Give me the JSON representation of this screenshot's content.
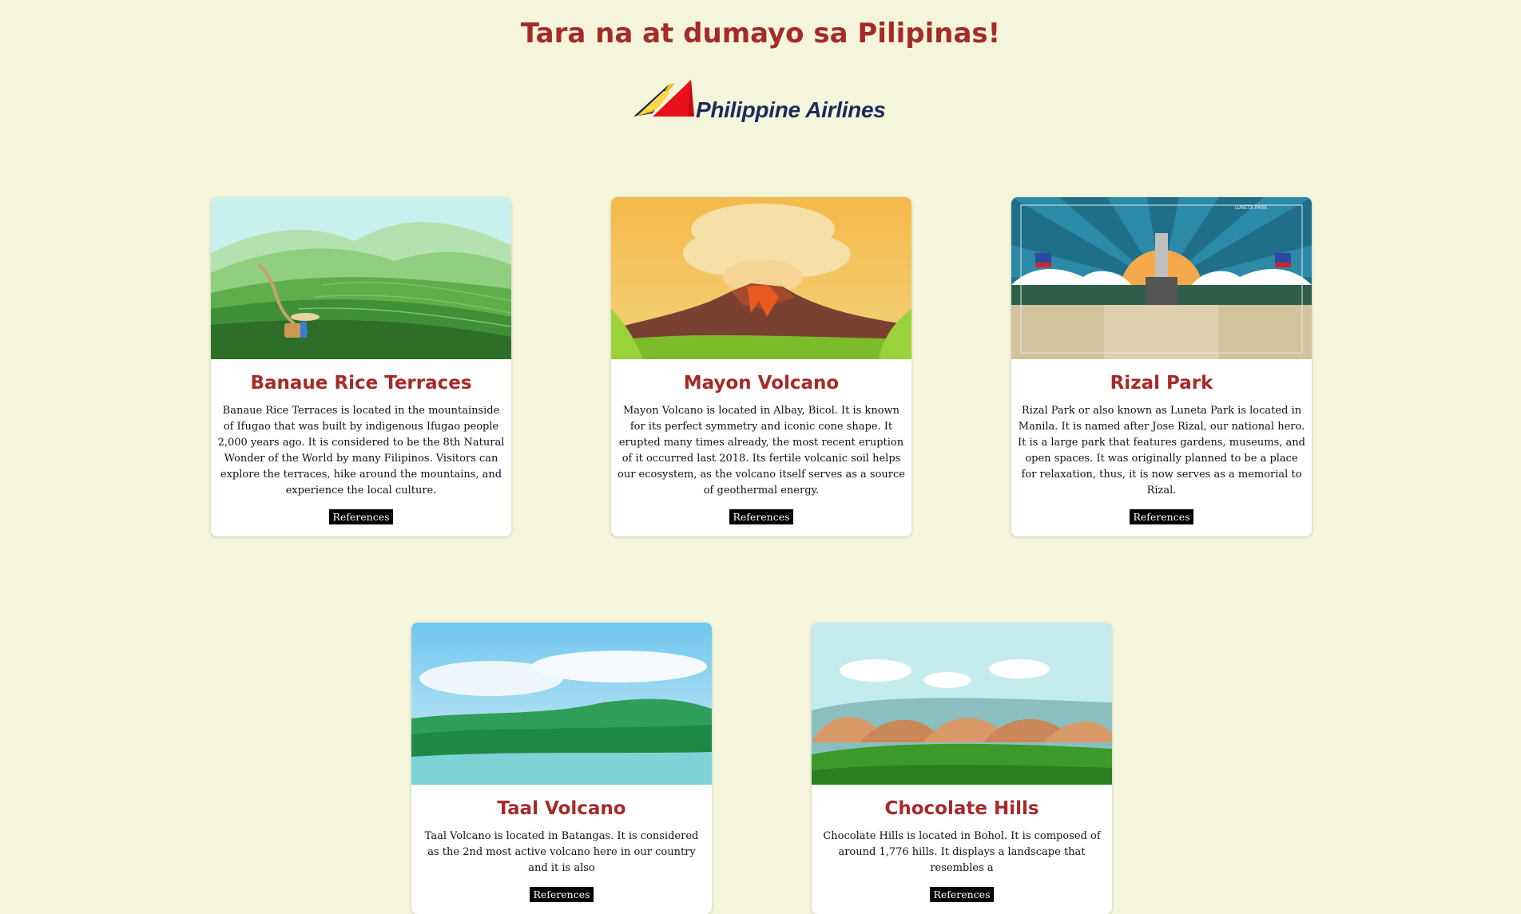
{
  "header": {
    "title": "Tara na at dumayo sa Pilipinas!",
    "logo_text": "Philippine Airlines"
  },
  "colors": {
    "background": "#f5f5dc",
    "accent": "#a52a2a",
    "button": "#000000"
  },
  "cards": [
    {
      "title": "Banaue Rice Terraces",
      "description": "Banaue Rice Terraces is located in the mountainside of Ifugao that was built by indigenous Ifugao people 2,000 years ago. It is considered to be the 8th Natural Wonder of the World by many Filipinos. Visitors can explore the terraces, hike around the mountains, and experience the local culture.",
      "button": "References"
    },
    {
      "title": "Mayon Volcano",
      "description": "Mayon Volcano is located in Albay, Bicol. It is known for its perfect symmetry and iconic cone shape. It erupted many times already, the most recent eruption of it occurred last 2018. Its fertile volcanic soil helps our ecosystem, as the volcano itself serves as a source of geothermal energy.",
      "button": "References"
    },
    {
      "title": "Rizal Park",
      "image_caption": "LUNETA PARK",
      "description": "Rizal Park or also known as Luneta Park is located in Manila. It is named after Jose Rizal, our national hero. It is a large park that features gardens, museums, and open spaces. It was originally planned to be a place for relaxation, thus, it is now serves as a memorial to Rizal.",
      "button": "References"
    },
    {
      "title": "Taal Volcano",
      "description": "Taal Volcano is located in Batangas. It is considered as the 2nd most active volcano here in our country and it is also",
      "button": "References"
    },
    {
      "title": "Chocolate Hills",
      "description": "Chocolate Hills is located in Bohol. It is composed of around 1,776 hills. It displays a landscape that resembles a",
      "button": "References"
    }
  ]
}
